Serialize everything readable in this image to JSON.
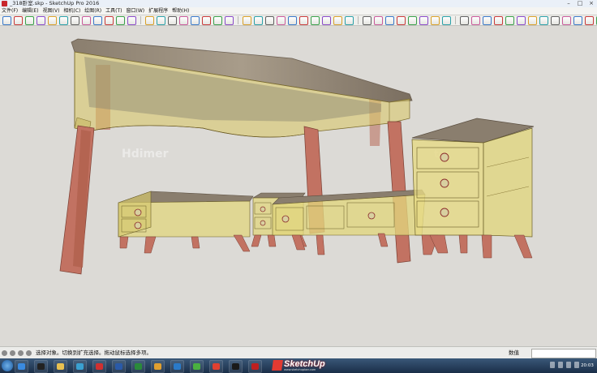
{
  "window": {
    "title": "_318卧室.skp - SketchUp Pro 2016"
  },
  "menu": [
    "文件(F)",
    "编辑(E)",
    "视图(V)",
    "相机(C)",
    "绘图(R)",
    "工具(T)",
    "窗口(W)",
    "扩展程序",
    "帮助(H)"
  ],
  "toolbar": {
    "icons": [
      "select",
      "eraser",
      "paint",
      "line",
      "arc",
      "rectangle",
      "circle",
      "polygon",
      "push-pull",
      "move",
      "rotate",
      "scale",
      "offset",
      "follow-me",
      "tape",
      "protractor",
      "text",
      "dimension",
      "axes",
      "3d-text",
      "orbit",
      "pan",
      "zoom",
      "zoom-window",
      "zoom-extents",
      "previous",
      "next",
      "position-camera",
      "walk",
      "look-around",
      "section-plane",
      "component",
      "group",
      "outliner",
      "layers",
      "styles",
      "shadows",
      "fog",
      "match-photo",
      "soften",
      "sandbox-from-contours",
      "sandbox-from-scratch",
      "smoove",
      "stamp",
      "drape",
      "add-detail",
      "flip-edge",
      "warehouse",
      "extension-warehouse",
      "layout",
      "style-builder"
    ],
    "accent": "#2a6cc8"
  },
  "viewport": {
    "background": "#dcdad6",
    "watermark": "Hdimer",
    "model": "bedroom-furniture-xray"
  },
  "status": {
    "message": "选择对象。切换到扩充选择。拖动鼠标选择多项。",
    "vcb_label": "数值",
    "vcb_value": ""
  },
  "taskbar": {
    "apps": [
      "ie-icon",
      "qq-icon",
      "folder-icon",
      "media-icon",
      "sketchup-icon",
      "word-icon",
      "excel-icon",
      "browser-icon",
      "k-app-icon",
      "green-app-icon",
      "chrome-icon",
      "media-player-icon",
      "autocad-icon",
      "photoshop-icon",
      "settings-icon"
    ],
    "logo_text": "SketchUp",
    "logo_sub": "www.sketchupbar.com",
    "clock": "20:03"
  }
}
